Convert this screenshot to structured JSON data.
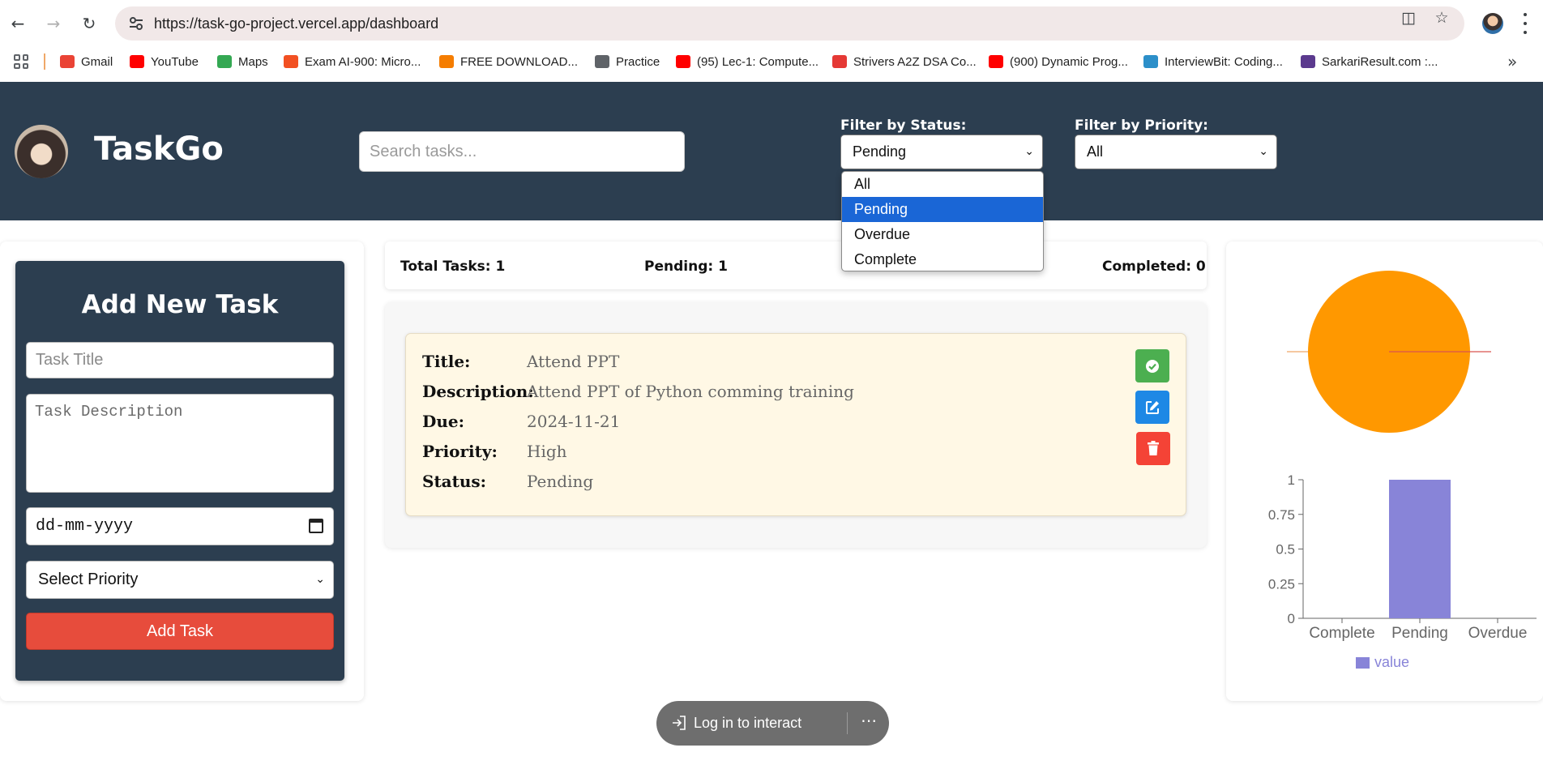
{
  "browser": {
    "url": "https://task-go-project.vercel.app/dashboard",
    "bookmarks": [
      {
        "label": "Gmail",
        "icon": "gmail-icon",
        "color": "#ea4335"
      },
      {
        "label": "YouTube",
        "icon": "youtube-icon",
        "color": "#ff0000"
      },
      {
        "label": "Maps",
        "icon": "maps-icon",
        "color": "#34a853"
      },
      {
        "label": "Exam AI-900: Micro...",
        "icon": "microsoft-icon",
        "color": "#f25022"
      },
      {
        "label": "FREE DOWNLOAD...",
        "icon": "blogger-icon",
        "color": "#f57d00"
      },
      {
        "label": "Practice",
        "icon": "rocket-icon",
        "color": "#5f6368"
      },
      {
        "label": "(95) Lec-1: Compute...",
        "icon": "youtube-icon",
        "color": "#ff0000"
      },
      {
        "label": "Strivers A2Z DSA Co...",
        "icon": "tuf-icon",
        "color": "#e53935"
      },
      {
        "label": "(900) Dynamic Prog...",
        "icon": "youtube-icon",
        "color": "#ff0000"
      },
      {
        "label": "InterviewBit: Coding...",
        "icon": "interviewbit-icon",
        "color": "#2c8fc9"
      },
      {
        "label": "SarkariResult.com :...",
        "icon": "globe-icon",
        "color": "#5b3a8e"
      }
    ]
  },
  "header": {
    "brand": "TaskGo",
    "search_placeholder": "Search tasks...",
    "status_filter_label": "Filter by Status:",
    "status_filter_value": "Pending",
    "priority_filter_label": "Filter by Priority:",
    "priority_filter_value": "All"
  },
  "status_dropdown": {
    "options": [
      "All",
      "Pending",
      "Overdue",
      "Complete"
    ],
    "selected": "Pending"
  },
  "form": {
    "title": "Add New Task",
    "title_placeholder": "Task Title",
    "description_placeholder": "Task Description",
    "date_placeholder": "dd-mm-yyyy",
    "priority_placeholder": "Select Priority",
    "submit_label": "Add Task"
  },
  "stats": {
    "total": "Total Tasks: 1",
    "pending": "Pending: 1",
    "completed": "Completed: 0"
  },
  "task": {
    "labels": {
      "title": "Title:",
      "description": "Description:",
      "due": "Due:",
      "priority": "Priority:",
      "status": "Status:"
    },
    "title": "Attend PPT",
    "description": "Attend PPT of Python comming training",
    "due": "2024-11-21",
    "priority": "High",
    "status": "Pending"
  },
  "colors": {
    "header_bg": "#2c3e50",
    "add_button": "#e74c3c",
    "complete_button": "#4caf50",
    "edit_button": "#1e88e5",
    "delete_button": "#f44336",
    "pie_color": "#ff9800",
    "bar_color": "#8884d8"
  },
  "chart_data": [
    {
      "type": "pie",
      "categories": [
        "Complete",
        "Pending",
        "Overdue"
      ],
      "values": [
        0,
        1,
        0
      ]
    },
    {
      "type": "bar",
      "categories": [
        "Complete",
        "Pending",
        "Overdue"
      ],
      "series": [
        {
          "name": "value",
          "values": [
            0,
            1,
            0
          ]
        }
      ],
      "yticks": [
        "0",
        "0.25",
        "0.5",
        "0.75",
        "1"
      ],
      "ylim": [
        0,
        1
      ],
      "legend": "bottom"
    }
  ],
  "floating": {
    "login_label": "Log in to interact"
  }
}
